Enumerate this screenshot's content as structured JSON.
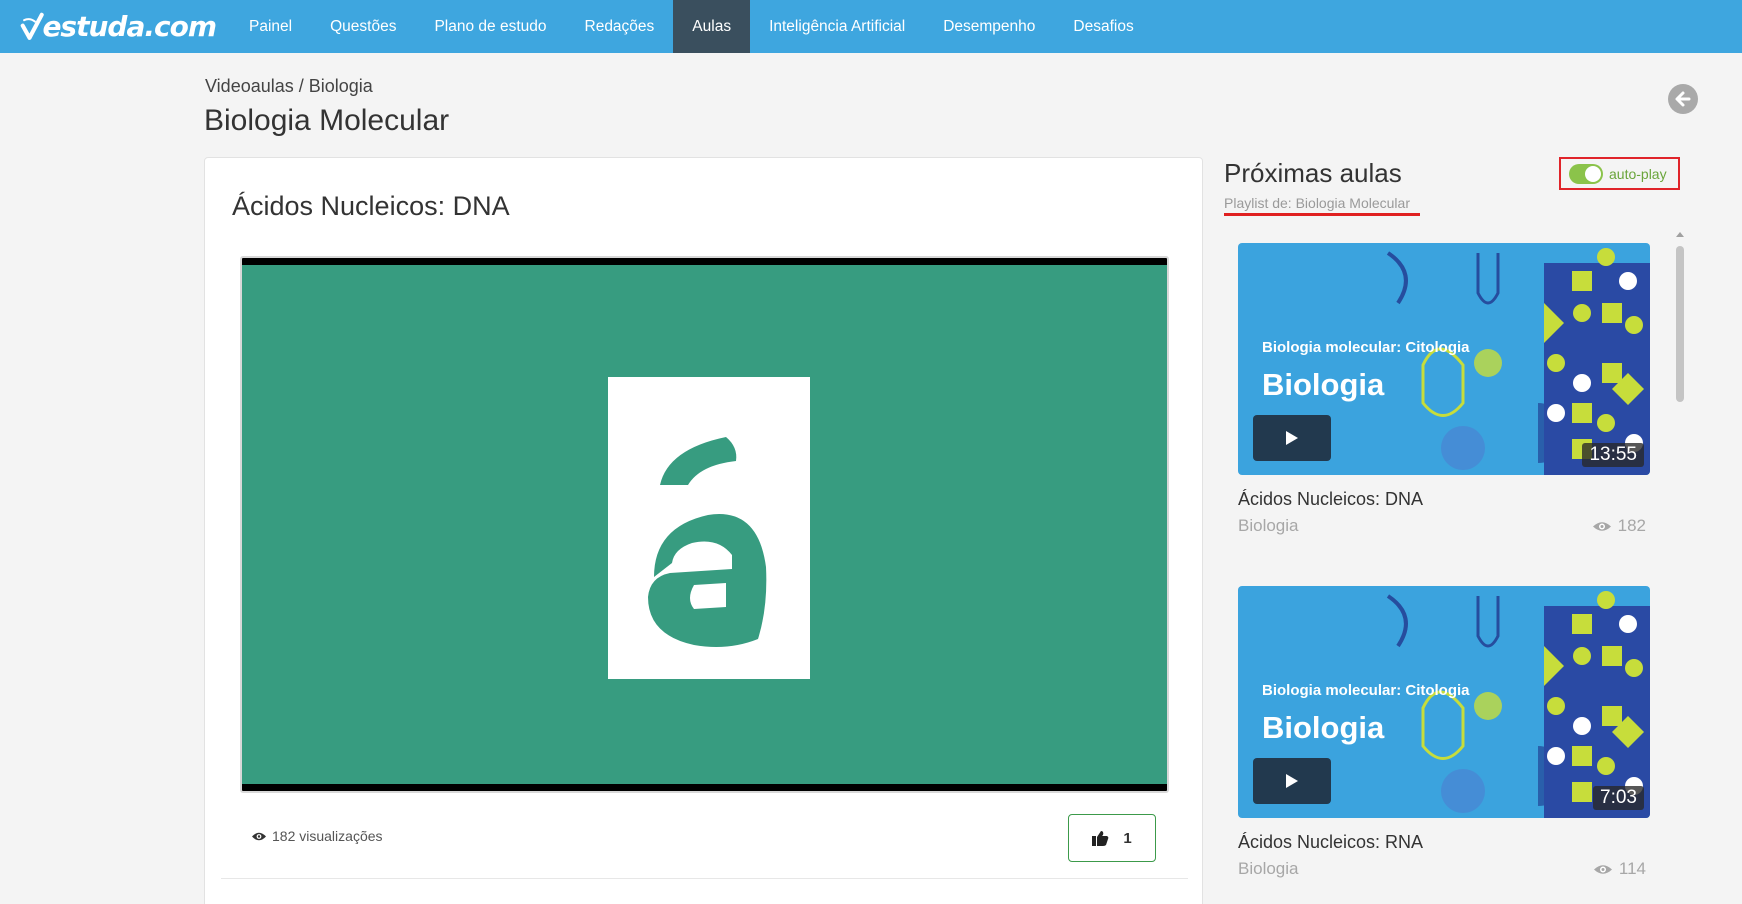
{
  "brand": {
    "name": "estuda.com",
    "color": "#3ea6df"
  },
  "nav": {
    "items": [
      {
        "label": "Painel"
      },
      {
        "label": "Questões"
      },
      {
        "label": "Plano de estudo"
      },
      {
        "label": "Redações"
      },
      {
        "label": "Aulas",
        "active": true
      },
      {
        "label": "Inteligência Artificial"
      },
      {
        "label": "Desempenho"
      },
      {
        "label": "Desafios"
      }
    ]
  },
  "breadcrumb": "Videoaulas / Biologia",
  "page_title": "Biologia Molecular",
  "lesson": {
    "title": "Ácidos Nucleicos: DNA",
    "views_text": "182 visualizações",
    "likes": "1",
    "player_icon": "estuda-a-logo"
  },
  "sidebar": {
    "title": "Próximas aulas",
    "playlist_label": "Playlist de: Biologia Molecular",
    "autoplay_label": "auto-play",
    "autoplay_on": true,
    "videos": [
      {
        "thumb_subtitle": "Biologia molecular: Citologia",
        "thumb_title": "Biologia",
        "duration": "13:55",
        "title": "Ácidos Nucleicos: DNA",
        "subject": "Biologia",
        "views": "182"
      },
      {
        "thumb_subtitle": "Biologia molecular: Citologia",
        "thumb_title": "Biologia",
        "duration": "7:03",
        "title": "Ácidos Nucleicos: RNA",
        "subject": "Biologia",
        "views": "114"
      }
    ]
  },
  "colors": {
    "nav_active": "#3a4f5e",
    "player_bg": "#379c80",
    "autoplay_green": "#8bc34a",
    "highlight_red": "#e0242a",
    "thumb_blue": "#3ba3de"
  }
}
